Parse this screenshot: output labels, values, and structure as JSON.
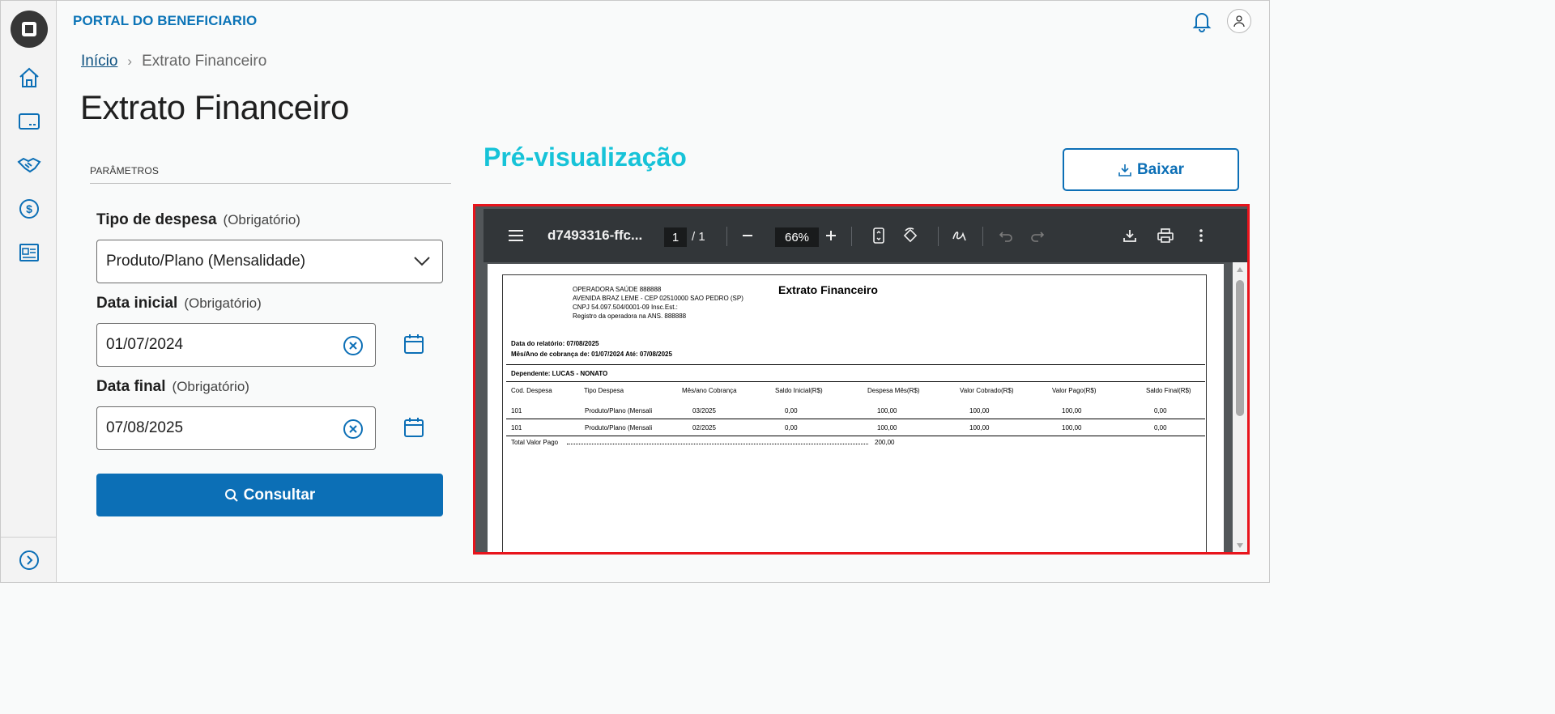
{
  "header": {
    "portal_title": "PORTAL DO BENEFICIARIO"
  },
  "breadcrumb": {
    "home": "Início",
    "current": "Extrato Financeiro"
  },
  "page_title": "Extrato Financeiro",
  "params": {
    "section_label": "PARÂMETROS",
    "tipo_despesa": {
      "label": "Tipo de despesa",
      "required": "(Obrigatório)",
      "value": "Produto/Plano (Mensalidade)"
    },
    "data_inicial": {
      "label": "Data inicial",
      "required": "(Obrigatório)",
      "value": "01/07/2024"
    },
    "data_final": {
      "label": "Data final",
      "required": "(Obrigatório)",
      "value": "07/08/2025"
    },
    "consultar_label": "Consultar"
  },
  "preview": {
    "title": "Pré-visualização",
    "download_label": "Baixar",
    "viewer": {
      "file_name": "d7493316-ffc...",
      "page_current": "1",
      "page_total": "/  1",
      "zoom": "66%"
    },
    "document": {
      "operator_lines": [
        "OPERADORA SAÚDE 888888",
        "AVENIDA BRAZ LEME - CEP 02510000 SAO PEDRO (SP)",
        "CNPJ 54.097.504/0001-09  Insc.Est.:",
        "Registro da operadora na ANS. 888888"
      ],
      "title": "Extrato Financeiro",
      "report_date": "Data do relatório: 07/08/2025",
      "billing_period": "Mês/Ano de cobrança de: 01/07/2024 Até: 07/08/2025",
      "dependent": "Dependente: LUCAS - NONATO",
      "columns": [
        "Cod. Despesa",
        "Tipo Despesa",
        "Mês/ano Cobrança",
        "Saldo Inicial(R$)",
        "Despesa Mês(R$)",
        "Valor Cobrado(R$)",
        "Valor Pago(R$)",
        "Saldo Final(R$)"
      ],
      "rows": [
        [
          "101",
          "Produto/Plano (Mensali",
          "03/2025",
          "0,00",
          "100,00",
          "100,00",
          "100,00",
          "0,00"
        ],
        [
          "101",
          "Produto/Plano (Mensali",
          "02/2025",
          "0,00",
          "100,00",
          "100,00",
          "100,00",
          "0,00"
        ]
      ],
      "total_label": "Total Valor Pago",
      "total_value": "200,00"
    }
  },
  "colors": {
    "brand_blue": "#0c6fb6",
    "preview_title": "#17c3d8",
    "highlight_border": "#e8141c"
  }
}
